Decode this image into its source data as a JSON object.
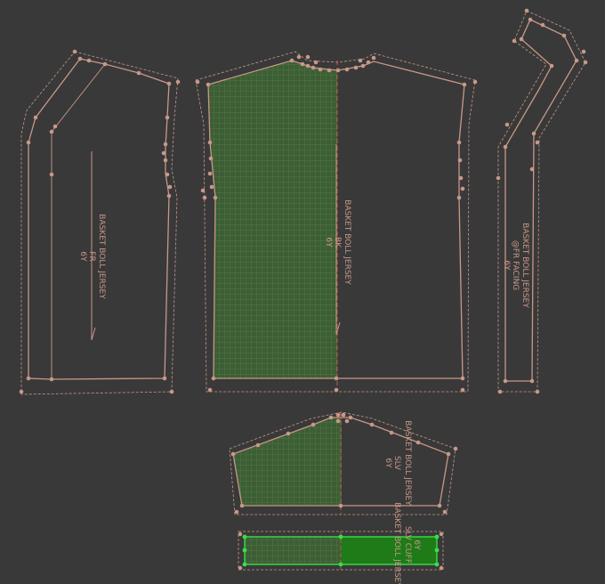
{
  "colors": {
    "background": "#393939",
    "outline": "#c89888",
    "point": "#c89888",
    "grain": "#c05a4a",
    "selected_fill": "#3d5e34",
    "active_fill": "#1f7a18",
    "active_point": "#36e04a",
    "grid": "#5d8a52"
  },
  "pieces": {
    "front": {
      "line1": "BASKET BOLL JERSEY",
      "line2": "FR",
      "line3": "6Y"
    },
    "back": {
      "line1": "BASKET BOLL JERSEY",
      "line2": "BK",
      "line3": "6Y"
    },
    "facing": {
      "line1": "BASKET BOLL JERSEY",
      "line2": "@FR FACING",
      "line3": "6Y"
    },
    "sleeve": {
      "line1": "BASKET BOLL JERSEY",
      "line2": "SLV",
      "line3": "6Y"
    },
    "cuff": {
      "line1": "BASKET BOLL JERSEY",
      "line2": "SLV CUFF",
      "line3": "6Y"
    }
  }
}
